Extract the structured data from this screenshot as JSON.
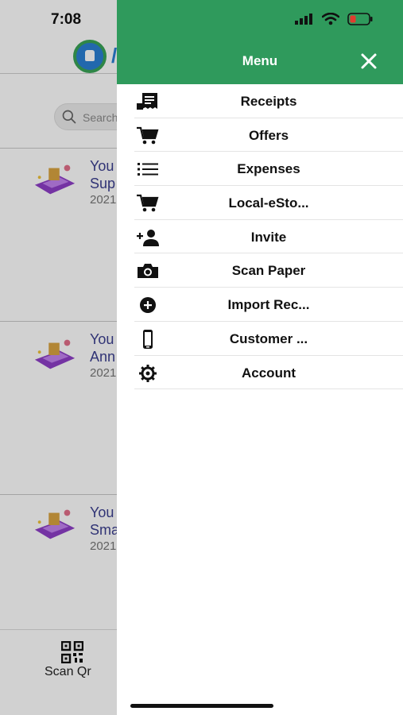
{
  "status_bar": {
    "time": "7:08"
  },
  "background": {
    "search_placeholder": "Search",
    "cards": [
      {
        "line1": "You",
        "line2": "Sup",
        "date": "2021"
      },
      {
        "line1": "You",
        "line2": "Ann",
        "date": "2021"
      },
      {
        "line1": "You",
        "line2": "Sma",
        "date": "2021"
      }
    ],
    "bottom_nav": {
      "scan_label": "Scan Qr"
    }
  },
  "drawer": {
    "title": "Menu",
    "accent_color": "#2f9a5c",
    "items": [
      {
        "label": "Receipts",
        "icon": "receipt-icon"
      },
      {
        "label": "Offers",
        "icon": "cart-icon"
      },
      {
        "label": "Expenses",
        "icon": "list-icon"
      },
      {
        "label": "Local-eSto...",
        "icon": "cart-icon"
      },
      {
        "label": "Invite",
        "icon": "add-person-icon"
      },
      {
        "label": "Scan Paper",
        "icon": "camera-icon"
      },
      {
        "label": "Import Rec...",
        "icon": "plus-circle-icon"
      },
      {
        "label": "Customer ...",
        "icon": "phone-icon"
      },
      {
        "label": "Account",
        "icon": "gear-icon"
      }
    ]
  }
}
